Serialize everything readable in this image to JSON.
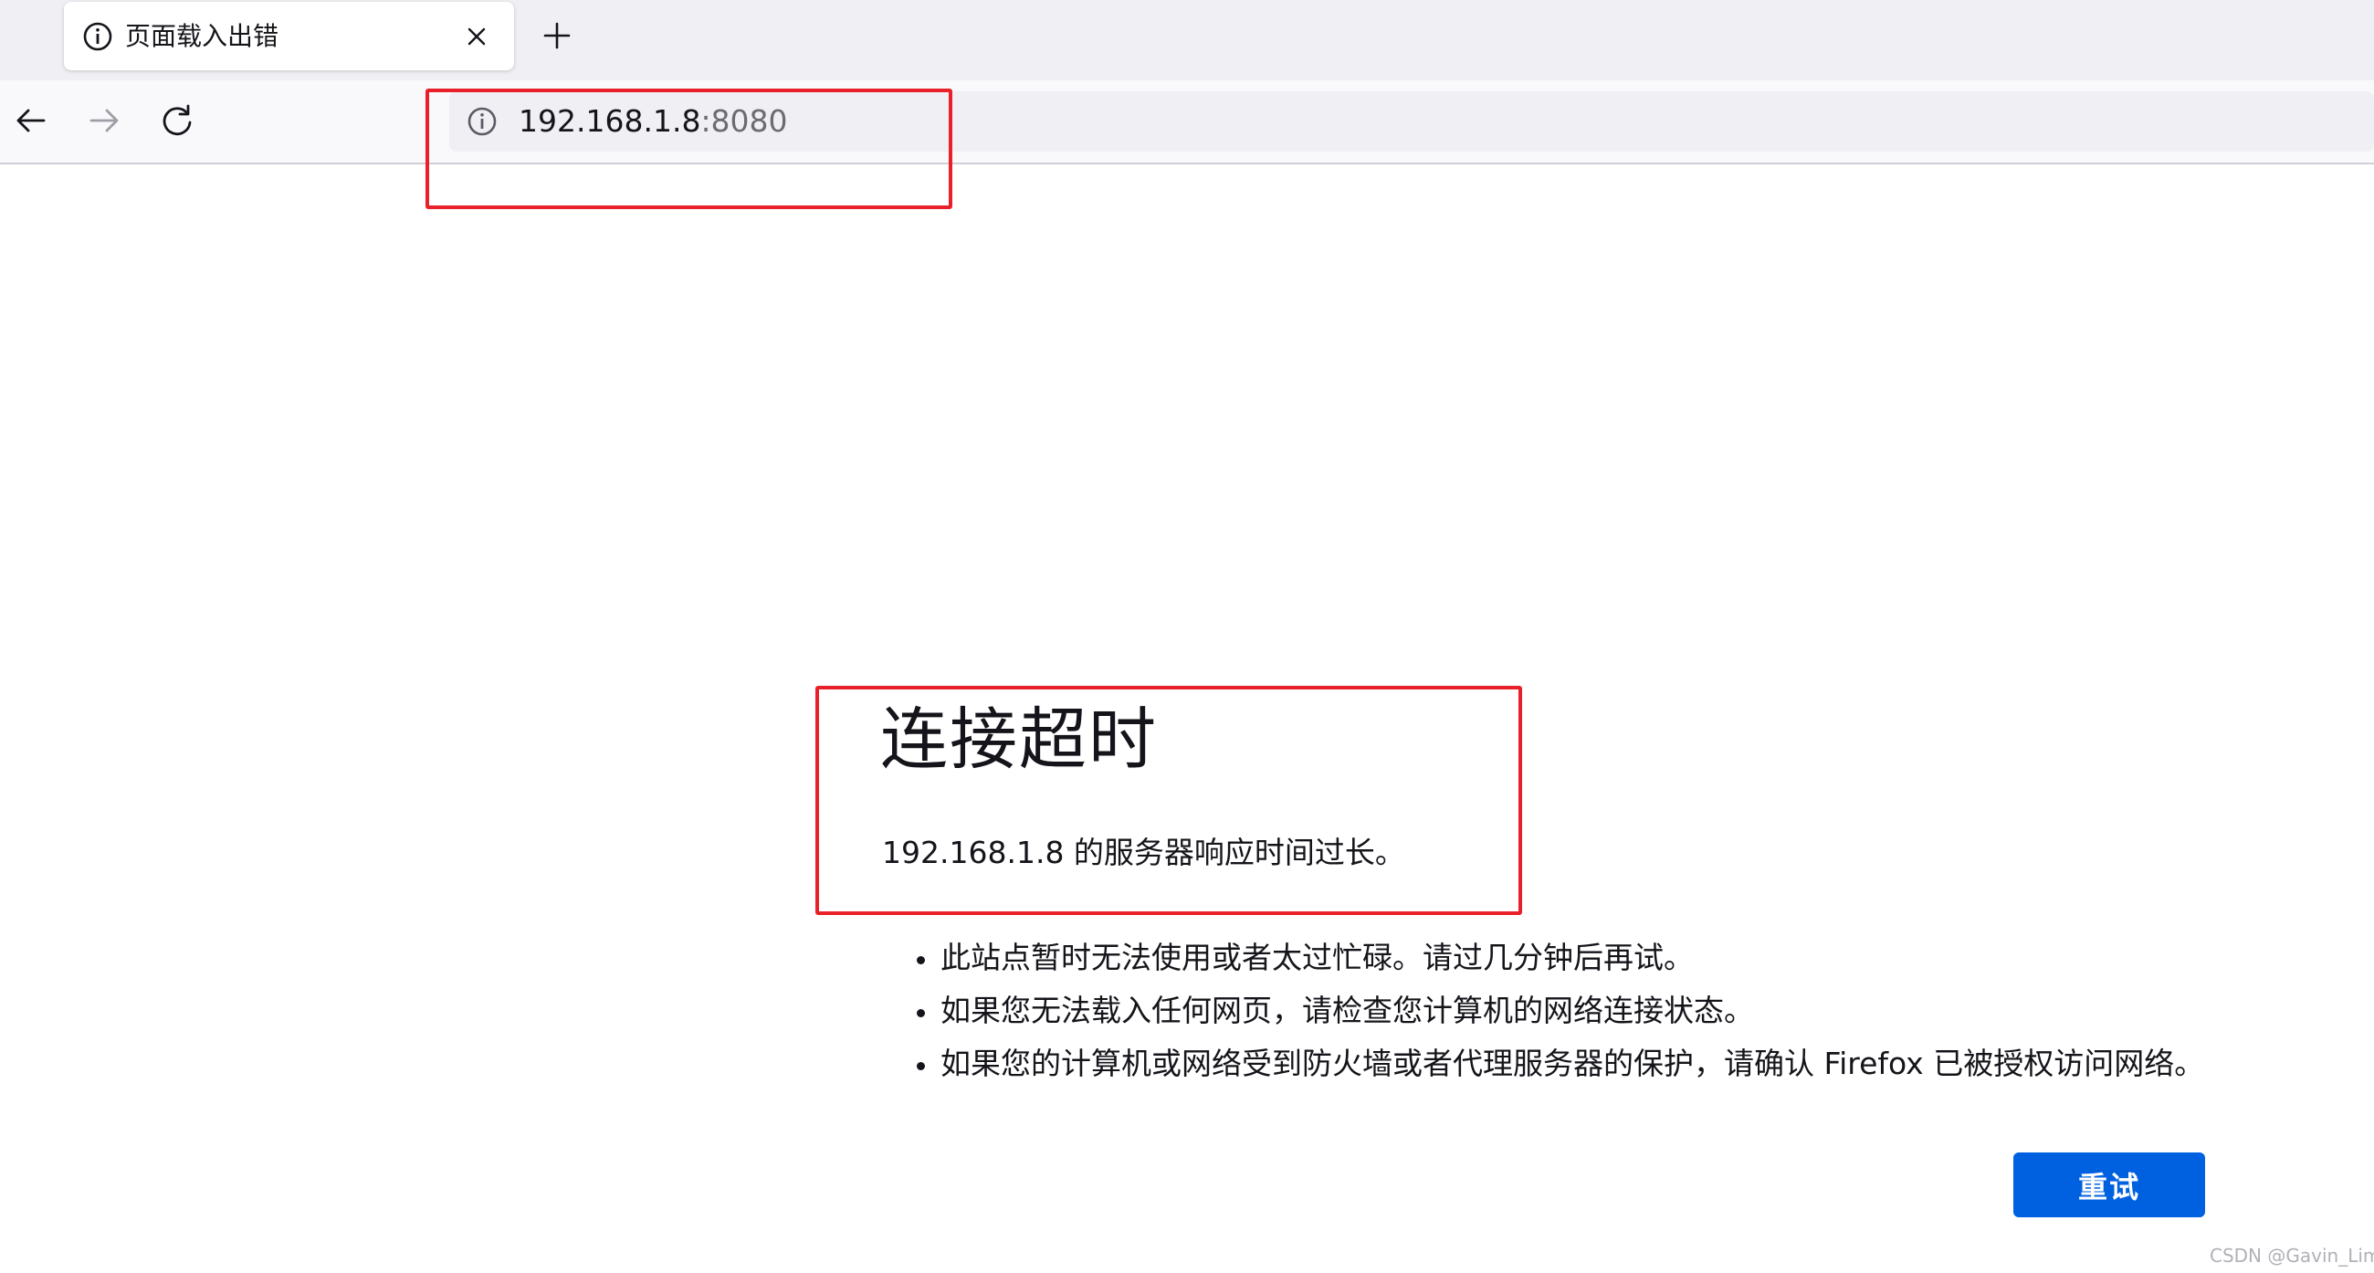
{
  "tab": {
    "title": "页面载入出错",
    "icon": "info-icon",
    "close_icon": "close-icon",
    "new_tab_icon": "plus-icon"
  },
  "nav": {
    "back_icon": "arrow-left-icon",
    "forward_icon": "arrow-right-icon",
    "reload_icon": "reload-icon"
  },
  "urlbar": {
    "host": "192.168.1.8",
    "port": ":8080",
    "icon": "info-icon"
  },
  "error": {
    "title": "连接超时",
    "description": "192.168.1.8 的服务器响应时间过长。",
    "suggestions": [
      "此站点暂时无法使用或者太过忙碌。请过几分钟后再试。",
      "如果您无法载入任何网页，请检查您计算机的网络连接状态。",
      "如果您的计算机或网络受到防火墙或者代理服务器的保护，请确认 Firefox 已被授权访问网络。"
    ],
    "retry_label": "重试"
  },
  "watermark": "CSDN @Gavin_Lim",
  "colors": {
    "accent": "#0061e0",
    "highlight": "#e8202a",
    "tabstrip_bg": "#f0f0f4",
    "urlbar_bg": "#f0f0f4"
  }
}
